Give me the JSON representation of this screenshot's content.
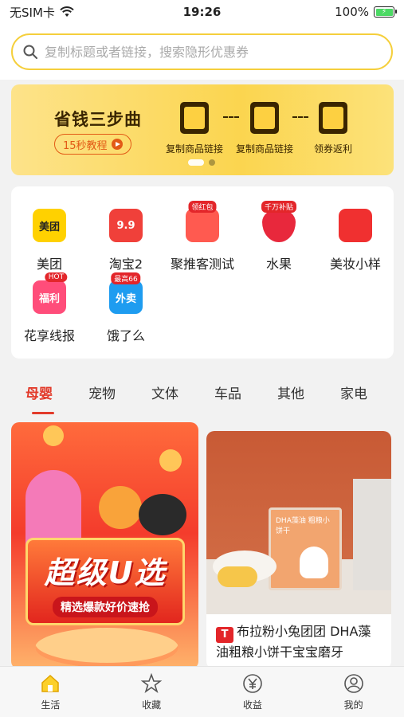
{
  "status_bar": {
    "carrier": "无SIM卡",
    "time": "19:26",
    "battery": "100%"
  },
  "search": {
    "placeholder": "复制标题或者链接，搜索隐形优惠券"
  },
  "banner": {
    "title": "省钱三步曲",
    "tutorial_label": "15秒教程",
    "steps": [
      {
        "label": "复制商品链接",
        "icon": "hand-pointer-icon"
      },
      {
        "label": "复制商品链接",
        "icon": "folder-icon"
      },
      {
        "label": "领券返利",
        "icon": "ticket-icon"
      }
    ],
    "page_indicator": {
      "current": 1,
      "total": 2
    }
  },
  "categories": [
    {
      "name": "美团",
      "icon_text": "美团",
      "color": "#ffd100"
    },
    {
      "name": "淘宝2",
      "icon_text": "9.9",
      "color": "#f0403a"
    },
    {
      "name": "聚推客测试",
      "icon_text": "",
      "tag": "领红包",
      "color": "#ff3b33"
    },
    {
      "name": "水果",
      "icon_text": "",
      "tag": "千万补贴",
      "color": "#e8283c"
    },
    {
      "name": "美妆小样",
      "icon_text": "",
      "color": "#f03030"
    },
    {
      "name": "花享线报",
      "icon_text": "福利",
      "tag": "HOT",
      "color": "#ff4d7a"
    },
    {
      "name": "饿了么",
      "icon_text": "外卖",
      "tag": "最高66",
      "color": "#1e9cf0"
    }
  ],
  "tabs": [
    "母婴",
    "宠物",
    "文体",
    "车品",
    "其他",
    "家电"
  ],
  "active_tab": 0,
  "products": [
    {
      "banner_text": "超级U选",
      "banner_sub": "精选爆款好价速抢"
    },
    {
      "box_text": "DHA藻油 粗粮小饼干",
      "title_badge": "T",
      "title": "布拉粉小兔团团 DHA藻油粗粮小饼干宝宝磨牙"
    }
  ],
  "bottom_nav": [
    {
      "label": "生活",
      "icon": "home-icon",
      "active": true
    },
    {
      "label": "收藏",
      "icon": "star-icon",
      "active": false
    },
    {
      "label": "收益",
      "icon": "yen-icon",
      "active": false
    },
    {
      "label": "我的",
      "icon": "user-icon",
      "active": false
    }
  ],
  "colors": {
    "accent_yellow": "#f5cf3c",
    "active_red": "#e23a2a"
  }
}
